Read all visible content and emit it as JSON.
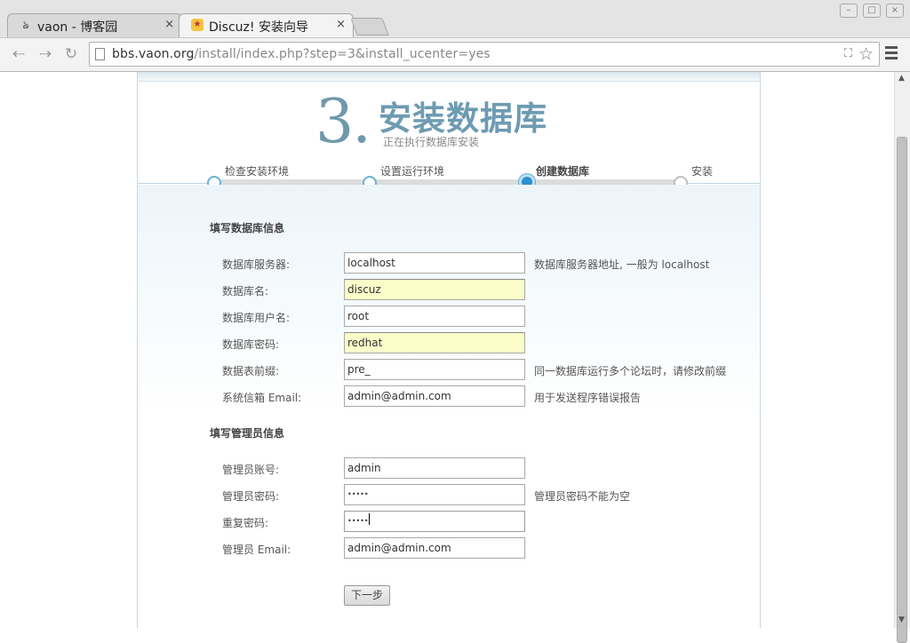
{
  "browser": {
    "tabs": [
      {
        "title": "vaon - 博客园",
        "favicon": "cnblogs-icon",
        "close": "×"
      },
      {
        "title": "Discuz! 安装向导",
        "favicon": "discuz-icon",
        "close": "×"
      }
    ],
    "url": {
      "host": "bbs.vaon.org",
      "path": "/install/index.php?step=3&install_ucenter=yes"
    },
    "nav": {
      "back": "⇠",
      "forward": "⇢",
      "reload": "↻"
    },
    "window_controls": {
      "minimize": "–",
      "maximize": "□",
      "close": "×"
    }
  },
  "page": {
    "step_number": "3.",
    "step_title": "安装数据库",
    "step_subtitle": "正在执行数据库安装",
    "progress": [
      {
        "label": "检查安装环境",
        "state": "done"
      },
      {
        "label": "设置运行环境",
        "state": "done"
      },
      {
        "label": "创建数据库",
        "state": "current"
      },
      {
        "label": "安装",
        "state": "todo"
      }
    ],
    "db_section_title": "填写数据库信息",
    "db_fields": [
      {
        "label": "数据库服务器:",
        "value": "localhost",
        "hint": "数据库服务器地址, 一般为 localhost"
      },
      {
        "label": "数据库名:",
        "value": "discuz",
        "hint": ""
      },
      {
        "label": "数据库用户名:",
        "value": "root",
        "hint": ""
      },
      {
        "label": "数据库密码:",
        "value": "redhat",
        "hint": ""
      },
      {
        "label": "数据表前缀:",
        "value": "pre_",
        "hint": "同一数据库运行多个论坛时，请修改前缀"
      },
      {
        "label": "系统信箱 Email:",
        "value": "admin@admin.com",
        "hint": "用于发送程序错误报告"
      }
    ],
    "admin_section_title": "填写管理员信息",
    "admin_fields": [
      {
        "label": "管理员账号:",
        "value": "admin",
        "hint": ""
      },
      {
        "label": "管理员密码:",
        "value": "•••••",
        "hint": "管理员密码不能为空"
      },
      {
        "label": "重复密码:",
        "value": "•••••",
        "hint": ""
      },
      {
        "label": "管理员 Email:",
        "value": "admin@admin.com",
        "hint": ""
      }
    ],
    "submit_label": "下一步"
  },
  "colors": {
    "accent": "#6d9bb2",
    "autofill": "#fbfdc9",
    "progress_current": "#2e8ed0"
  }
}
